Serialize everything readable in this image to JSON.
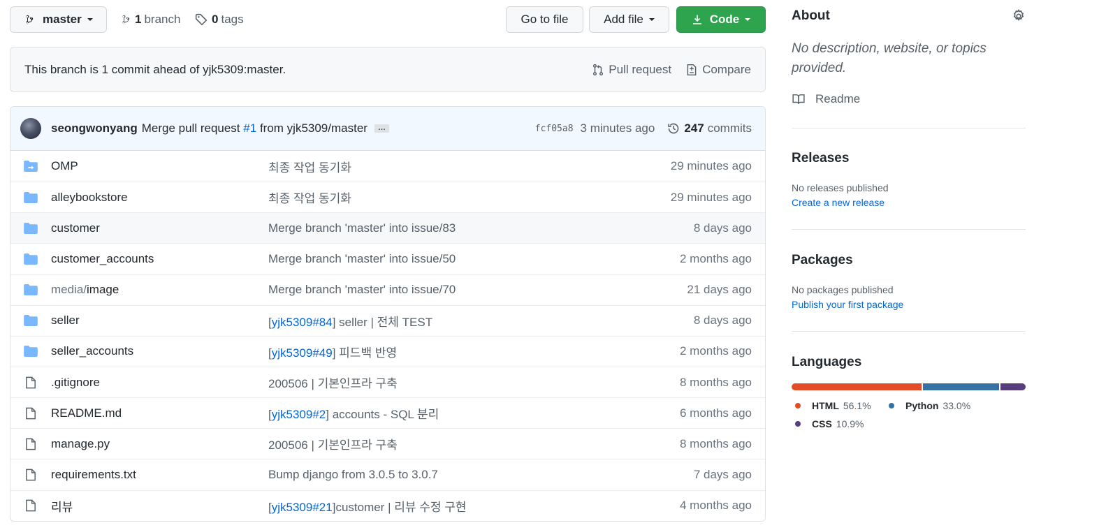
{
  "toolbar": {
    "branch_label": "master",
    "branches_count": "1",
    "branches_label": "branch",
    "tags_count": "0",
    "tags_label": "tags",
    "go_to_file": "Go to file",
    "add_file": "Add file",
    "code": "Code"
  },
  "ahead": {
    "message": "This branch is 1 commit ahead of yjk5309:master.",
    "pull_request": "Pull request",
    "compare": "Compare"
  },
  "commit": {
    "author": "seongwonyang",
    "message_prefix": "Merge pull request",
    "pr_link": "#1",
    "message_suffix": "from yjk5309/master",
    "ellipsis": "…",
    "sha": "fcf05a8",
    "time": "3 minutes ago",
    "commits_count": "247",
    "commits_label": "commits"
  },
  "files": [
    {
      "type": "submodule",
      "name": "OMP",
      "msg": "최종 작업 동기화",
      "age": "29 minutes ago"
    },
    {
      "type": "dir",
      "name": "alleybookstore",
      "msg": "최종 작업 동기화",
      "age": "29 minutes ago"
    },
    {
      "type": "dir",
      "name": "customer",
      "msg": "Merge branch 'master' into issue/83",
      "age": "8 days ago"
    },
    {
      "type": "dir",
      "name": "customer_accounts",
      "msg": "Merge branch 'master' into issue/50",
      "age": "2 months ago"
    },
    {
      "type": "dir",
      "name_prefix": "media/",
      "name": "image",
      "msg": "Merge branch 'master' into issue/70",
      "age": "21 days ago"
    },
    {
      "type": "dir",
      "name": "seller",
      "msg_link": "yjk5309#84",
      "msg": " seller | 전체 TEST",
      "age": "8 days ago"
    },
    {
      "type": "dir",
      "name": "seller_accounts",
      "msg_link": "yjk5309#49",
      "msg": " 피드백 반영",
      "age": "2 months ago"
    },
    {
      "type": "file",
      "name": ".gitignore",
      "msg": "200506 | 기본인프라 구축",
      "age": "8 months ago"
    },
    {
      "type": "file",
      "name": "README.md",
      "msg_link": "yjk5309#2",
      "msg": " accounts - SQL 분리",
      "age": "6 months ago"
    },
    {
      "type": "file",
      "name": "manage.py",
      "msg": "200506 | 기본인프라 구축",
      "age": "8 months ago"
    },
    {
      "type": "file",
      "name": "requirements.txt",
      "msg": "Bump django from 3.0.5 to 3.0.7",
      "age": "7 days ago"
    },
    {
      "type": "file",
      "name": "리뷰",
      "msg_link": "yjk5309#21",
      "msg": "customer | 리뷰 수정 구현",
      "age": "4 months ago"
    }
  ],
  "sidebar": {
    "about_title": "About",
    "about_desc": "No description, website, or topics provided.",
    "readme": "Readme",
    "releases_title": "Releases",
    "releases_none": "No releases published",
    "releases_link": "Create a new release",
    "packages_title": "Packages",
    "packages_none": "No packages published",
    "packages_link": "Publish your first package",
    "languages_title": "Languages",
    "languages": [
      {
        "name": "HTML",
        "percent": "56.1%",
        "value": 56.1,
        "color": "#e34c26"
      },
      {
        "name": "Python",
        "percent": "33.0%",
        "value": 33.0,
        "color": "#3572A5"
      },
      {
        "name": "CSS",
        "percent": "10.9%",
        "value": 10.9,
        "color": "#563d7c"
      }
    ]
  }
}
